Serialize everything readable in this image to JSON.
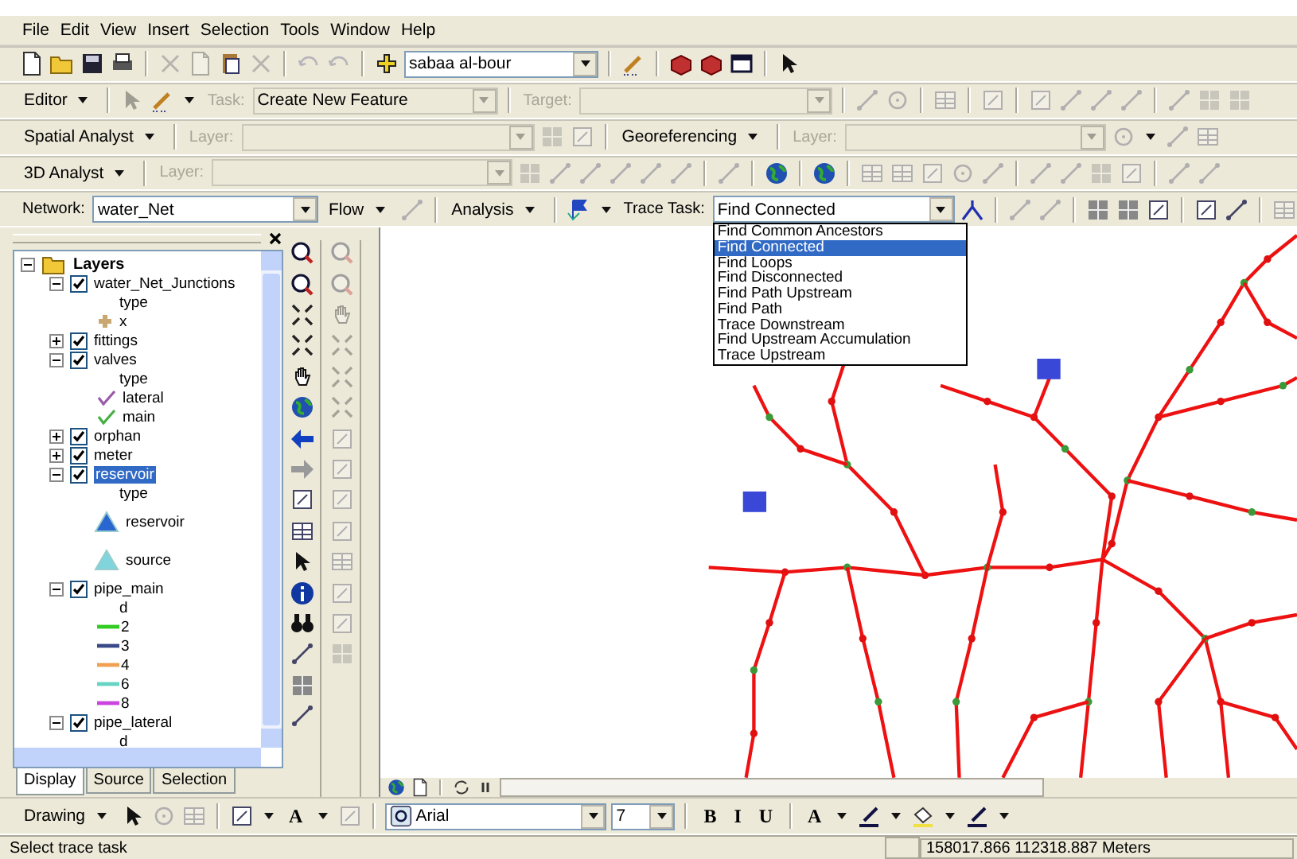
{
  "menu": [
    "File",
    "Edit",
    "View",
    "Insert",
    "Selection",
    "Tools",
    "Window",
    "Help"
  ],
  "toolbars": [
    {
      "items": [
        {
          "kind": "icon",
          "disabled": false
        },
        {
          "kind": "icon",
          "disabled": false
        },
        {
          "kind": "icon",
          "disabled": false
        },
        {
          "kind": "icon",
          "disabled": false
        },
        {
          "kind": "sep"
        },
        {
          "kind": "icon",
          "disabled": true
        },
        {
          "kind": "icon",
          "disabled": true
        },
        {
          "kind": "icon",
          "disabled": false
        },
        {
          "kind": "icon",
          "disabled": true
        },
        {
          "kind": "sep"
        },
        {
          "kind": "icon",
          "disabled": true
        },
        {
          "kind": "icon",
          "disabled": true
        },
        {
          "kind": "sep"
        },
        {
          "kind": "icon",
          "disabled": false
        },
        {
          "kind": "combo",
          "value": "sabaa al-bour",
          "disabled": false
        },
        {
          "kind": "sep"
        },
        {
          "kind": "icon",
          "disabled": false
        },
        {
          "kind": "sep"
        },
        {
          "kind": "icon",
          "disabled": false
        },
        {
          "kind": "icon",
          "disabled": false
        },
        {
          "kind": "icon",
          "disabled": false
        },
        {
          "kind": "sep"
        },
        {
          "kind": "icon",
          "disabled": false
        }
      ]
    },
    {
      "items": [
        {
          "kind": "menu",
          "label": "Editor",
          "disabled": false
        },
        {
          "kind": "sep"
        },
        {
          "kind": "icon",
          "disabled": true
        },
        {
          "kind": "icon",
          "disabled": false
        },
        {
          "kind": "drop",
          "disabled": false
        },
        {
          "kind": "label",
          "label": "Task:",
          "disabled": true
        },
        {
          "kind": "combo",
          "value": "Create New Feature",
          "disabled": true
        },
        {
          "kind": "sep"
        },
        {
          "kind": "label",
          "label": "Target:",
          "disabled": true
        },
        {
          "kind": "combo",
          "value": "",
          "disabled": true
        },
        {
          "kind": "sep"
        },
        {
          "kind": "icon",
          "disabled": true
        },
        {
          "kind": "icon",
          "disabled": true
        },
        {
          "kind": "sep"
        },
        {
          "kind": "icon",
          "disabled": true
        },
        {
          "kind": "sep"
        },
        {
          "kind": "icon",
          "disabled": true
        },
        {
          "kind": "sep"
        },
        {
          "kind": "icon",
          "disabled": true
        },
        {
          "kind": "icon",
          "disabled": true
        },
        {
          "kind": "icon",
          "disabled": true
        },
        {
          "kind": "icon",
          "disabled": true
        },
        {
          "kind": "sep"
        },
        {
          "kind": "icon",
          "disabled": true
        },
        {
          "kind": "icon",
          "disabled": true
        },
        {
          "kind": "icon",
          "disabled": true
        }
      ]
    },
    {
      "items": [
        {
          "kind": "menu",
          "label": "Spatial Analyst",
          "disabled": false
        },
        {
          "kind": "sep"
        },
        {
          "kind": "label",
          "label": "Layer:",
          "disabled": true
        },
        {
          "kind": "combo",
          "value": "",
          "disabled": true
        },
        {
          "kind": "icon",
          "disabled": true
        },
        {
          "kind": "icon",
          "disabled": true
        },
        {
          "kind": "sep"
        },
        {
          "kind": "menu",
          "label": "Georeferencing",
          "disabled": false
        },
        {
          "kind": "sep"
        },
        {
          "kind": "label",
          "label": "Layer:",
          "disabled": true
        },
        {
          "kind": "combo",
          "value": "",
          "disabled": true
        },
        {
          "kind": "icon",
          "disabled": true
        },
        {
          "kind": "drop",
          "disabled": false
        },
        {
          "kind": "icon",
          "disabled": true
        },
        {
          "kind": "icon",
          "disabled": true
        }
      ]
    },
    {
      "items": [
        {
          "kind": "menu",
          "label": "3D Analyst",
          "disabled": false
        },
        {
          "kind": "sep"
        },
        {
          "kind": "label",
          "label": "Layer:",
          "disabled": true
        },
        {
          "kind": "combo",
          "value": "",
          "disabled": true
        },
        {
          "kind": "icon",
          "disabled": true
        },
        {
          "kind": "icon",
          "disabled": true
        },
        {
          "kind": "icon",
          "disabled": true
        },
        {
          "kind": "icon",
          "disabled": true
        },
        {
          "kind": "icon",
          "disabled": true
        },
        {
          "kind": "icon",
          "disabled": true
        },
        {
          "kind": "sep"
        },
        {
          "kind": "icon",
          "disabled": true
        },
        {
          "kind": "sep"
        },
        {
          "kind": "icon",
          "disabled": false
        },
        {
          "kind": "sep"
        },
        {
          "kind": "icon",
          "disabled": false
        },
        {
          "kind": "sep"
        },
        {
          "kind": "icon",
          "disabled": true
        },
        {
          "kind": "icon",
          "disabled": true
        },
        {
          "kind": "icon",
          "disabled": true
        },
        {
          "kind": "icon",
          "disabled": true
        },
        {
          "kind": "icon",
          "disabled": true
        },
        {
          "kind": "sep"
        },
        {
          "kind": "icon",
          "disabled": true
        },
        {
          "kind": "icon",
          "disabled": true
        },
        {
          "kind": "icon",
          "disabled": true
        },
        {
          "kind": "icon",
          "disabled": true
        },
        {
          "kind": "sep"
        },
        {
          "kind": "icon",
          "disabled": true
        },
        {
          "kind": "icon",
          "disabled": true
        }
      ]
    },
    {
      "items": [
        {
          "kind": "label",
          "label": "Network:",
          "disabled": false
        },
        {
          "kind": "combo",
          "value": "water_Net",
          "disabled": false
        },
        {
          "kind": "menu",
          "label": "Flow",
          "disabled": false
        },
        {
          "kind": "icon",
          "disabled": true
        },
        {
          "kind": "sep"
        },
        {
          "kind": "menu",
          "label": "Analysis",
          "disabled": false
        },
        {
          "kind": "sep"
        },
        {
          "kind": "icon",
          "disabled": false
        },
        {
          "kind": "drop",
          "disabled": false
        },
        {
          "kind": "label",
          "label": "Trace Task:",
          "disabled": false
        },
        {
          "kind": "combo",
          "value": "Find Connected",
          "disabled": false,
          "options": [
            {
              "label": "Find Common Ancestors",
              "selected": false
            },
            {
              "label": "Find Connected",
              "selected": true
            },
            {
              "label": "Find Loops",
              "selected": false
            },
            {
              "label": "Find Disconnected",
              "selected": false
            },
            {
              "label": "Find Path Upstream",
              "selected": false
            },
            {
              "label": "Find Path",
              "selected": false
            },
            {
              "label": "Trace Downstream",
              "selected": false
            },
            {
              "label": "Find Upstream Accumulation",
              "selected": false
            },
            {
              "label": "Trace Upstream",
              "selected": false
            }
          ]
        },
        {
          "kind": "icon",
          "disabled": false
        },
        {
          "kind": "sep"
        },
        {
          "kind": "icon",
          "disabled": true
        },
        {
          "kind": "icon",
          "disabled": true
        },
        {
          "kind": "sep"
        },
        {
          "kind": "icon",
          "disabled": false
        },
        {
          "kind": "icon",
          "disabled": false
        },
        {
          "kind": "icon",
          "disabled": false
        },
        {
          "kind": "sep"
        },
        {
          "kind": "icon",
          "disabled": false
        },
        {
          "kind": "icon",
          "disabled": false
        },
        {
          "kind": "sep"
        },
        {
          "kind": "icon",
          "disabled": true
        }
      ]
    }
  ],
  "toc": {
    "tree": {
      "kind": "root",
      "label": "Layers",
      "expanded": true,
      "children": [
        {
          "kind": "layer",
          "label": "water_Net_Junctions",
          "checked": true,
          "expanded": true,
          "selected": false,
          "children": [
            {
              "kind": "heading",
              "label": "type"
            },
            {
              "kind": "point",
              "label": "x",
              "color": "#c8a870"
            }
          ]
        },
        {
          "kind": "layer",
          "label": "fittings",
          "checked": true,
          "expanded": false,
          "selected": false
        },
        {
          "kind": "layer",
          "label": "valves",
          "checked": true,
          "expanded": true,
          "selected": false,
          "children": [
            {
              "kind": "heading",
              "label": "type"
            },
            {
              "kind": "check",
              "label": "lateral",
              "color": "#9a5aa8"
            },
            {
              "kind": "check",
              "label": "main",
              "color": "#44b044"
            }
          ]
        },
        {
          "kind": "layer",
          "label": "orphan",
          "checked": true,
          "expanded": false,
          "selected": false
        },
        {
          "kind": "layer",
          "label": "meter",
          "checked": true,
          "expanded": false,
          "selected": false
        },
        {
          "kind": "layer",
          "label": "reservoir",
          "checked": true,
          "expanded": true,
          "selected": true,
          "children": [
            {
              "kind": "heading",
              "label": "type"
            },
            {
              "kind": "triangle",
              "label": "reservoir",
              "color": "#2a66d0"
            },
            {
              "kind": "triangle",
              "label": "source",
              "color": "#80d4dc"
            }
          ]
        },
        {
          "kind": "layer",
          "label": "pipe_main",
          "checked": true,
          "expanded": true,
          "selected": false,
          "children": [
            {
              "kind": "heading",
              "label": "d"
            },
            {
              "kind": "line",
              "label": "2",
              "color": "#33cc22"
            },
            {
              "kind": "line",
              "label": "3",
              "color": "#3a4a88"
            },
            {
              "kind": "line",
              "label": "4",
              "color": "#f0a050"
            },
            {
              "kind": "line",
              "label": "6",
              "color": "#66d4c4"
            },
            {
              "kind": "line",
              "label": "8",
              "color": "#cc44e0"
            }
          ]
        },
        {
          "kind": "layer",
          "label": "pipe_lateral",
          "checked": true,
          "expanded": true,
          "selected": false,
          "children": [
            {
              "kind": "heading",
              "label": "d"
            }
          ]
        }
      ]
    },
    "tabs": [
      {
        "label": "Display",
        "selected": true
      },
      {
        "label": "Source",
        "selected": false
      },
      {
        "label": "Selection",
        "selected": false
      }
    ]
  },
  "tool_columns": [
    {
      "disabled": false
    },
    {
      "disabled": true
    }
  ],
  "drawing_toolbar": {
    "items": [
      {
        "kind": "menu",
        "label": "Drawing",
        "disabled": false
      },
      {
        "kind": "icon",
        "disabled": false
      },
      {
        "kind": "icon",
        "disabled": true
      },
      {
        "kind": "icon",
        "disabled": true
      },
      {
        "kind": "sep"
      },
      {
        "kind": "icon",
        "disabled": false
      },
      {
        "kind": "drop",
        "disabled": false
      },
      {
        "kind": "text",
        "label": "A",
        "disabled": false
      },
      {
        "kind": "drop",
        "disabled": false
      },
      {
        "kind": "icon",
        "disabled": true
      },
      {
        "kind": "sep"
      },
      {
        "kind": "combo",
        "value": "Arial",
        "disabled": false
      },
      {
        "kind": "combo",
        "value": "7",
        "disabled": false
      },
      {
        "kind": "sep"
      },
      {
        "kind": "text",
        "label": "B",
        "disabled": false
      },
      {
        "kind": "text",
        "label": "I",
        "disabled": false
      },
      {
        "kind": "text",
        "label": "U",
        "disabled": false
      },
      {
        "kind": "sep"
      },
      {
        "kind": "text",
        "label": "A",
        "disabled": false
      },
      {
        "kind": "drop",
        "disabled": false
      },
      {
        "kind": "icon",
        "disabled": false
      },
      {
        "kind": "drop",
        "disabled": false
      },
      {
        "kind": "icon",
        "disabled": false
      },
      {
        "kind": "drop",
        "disabled": false
      },
      {
        "kind": "icon",
        "disabled": false
      },
      {
        "kind": "drop",
        "disabled": false
      }
    ]
  },
  "status_bar": {
    "message": "Select trace task",
    "coordinates": "158017.866  112318.887 Meters"
  }
}
